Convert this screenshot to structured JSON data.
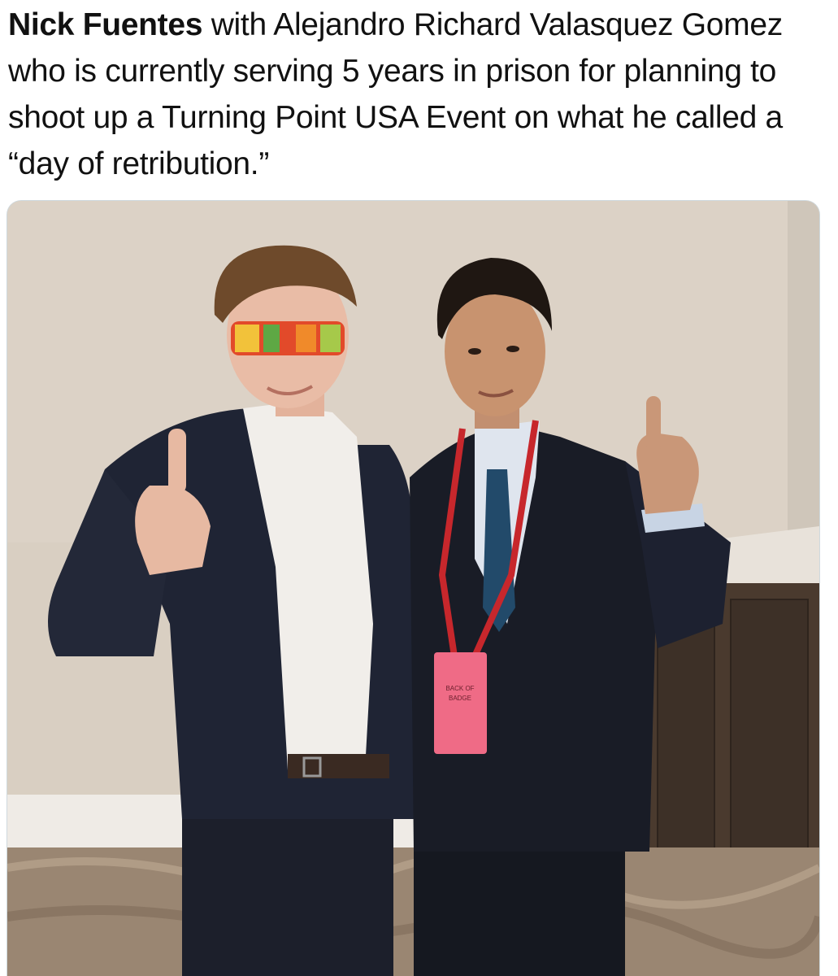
{
  "post": {
    "author": "Nick Fuentes",
    "body": " with Alejandro Richard Valasquez Gomez who is currently serving 5 years in prison for planning to shoot up a Turning Point USA Event on what he called a “day of retribution.”"
  },
  "media": {
    "badge_text_line1": "BACK OF",
    "badge_text_line2": "BADGE"
  }
}
